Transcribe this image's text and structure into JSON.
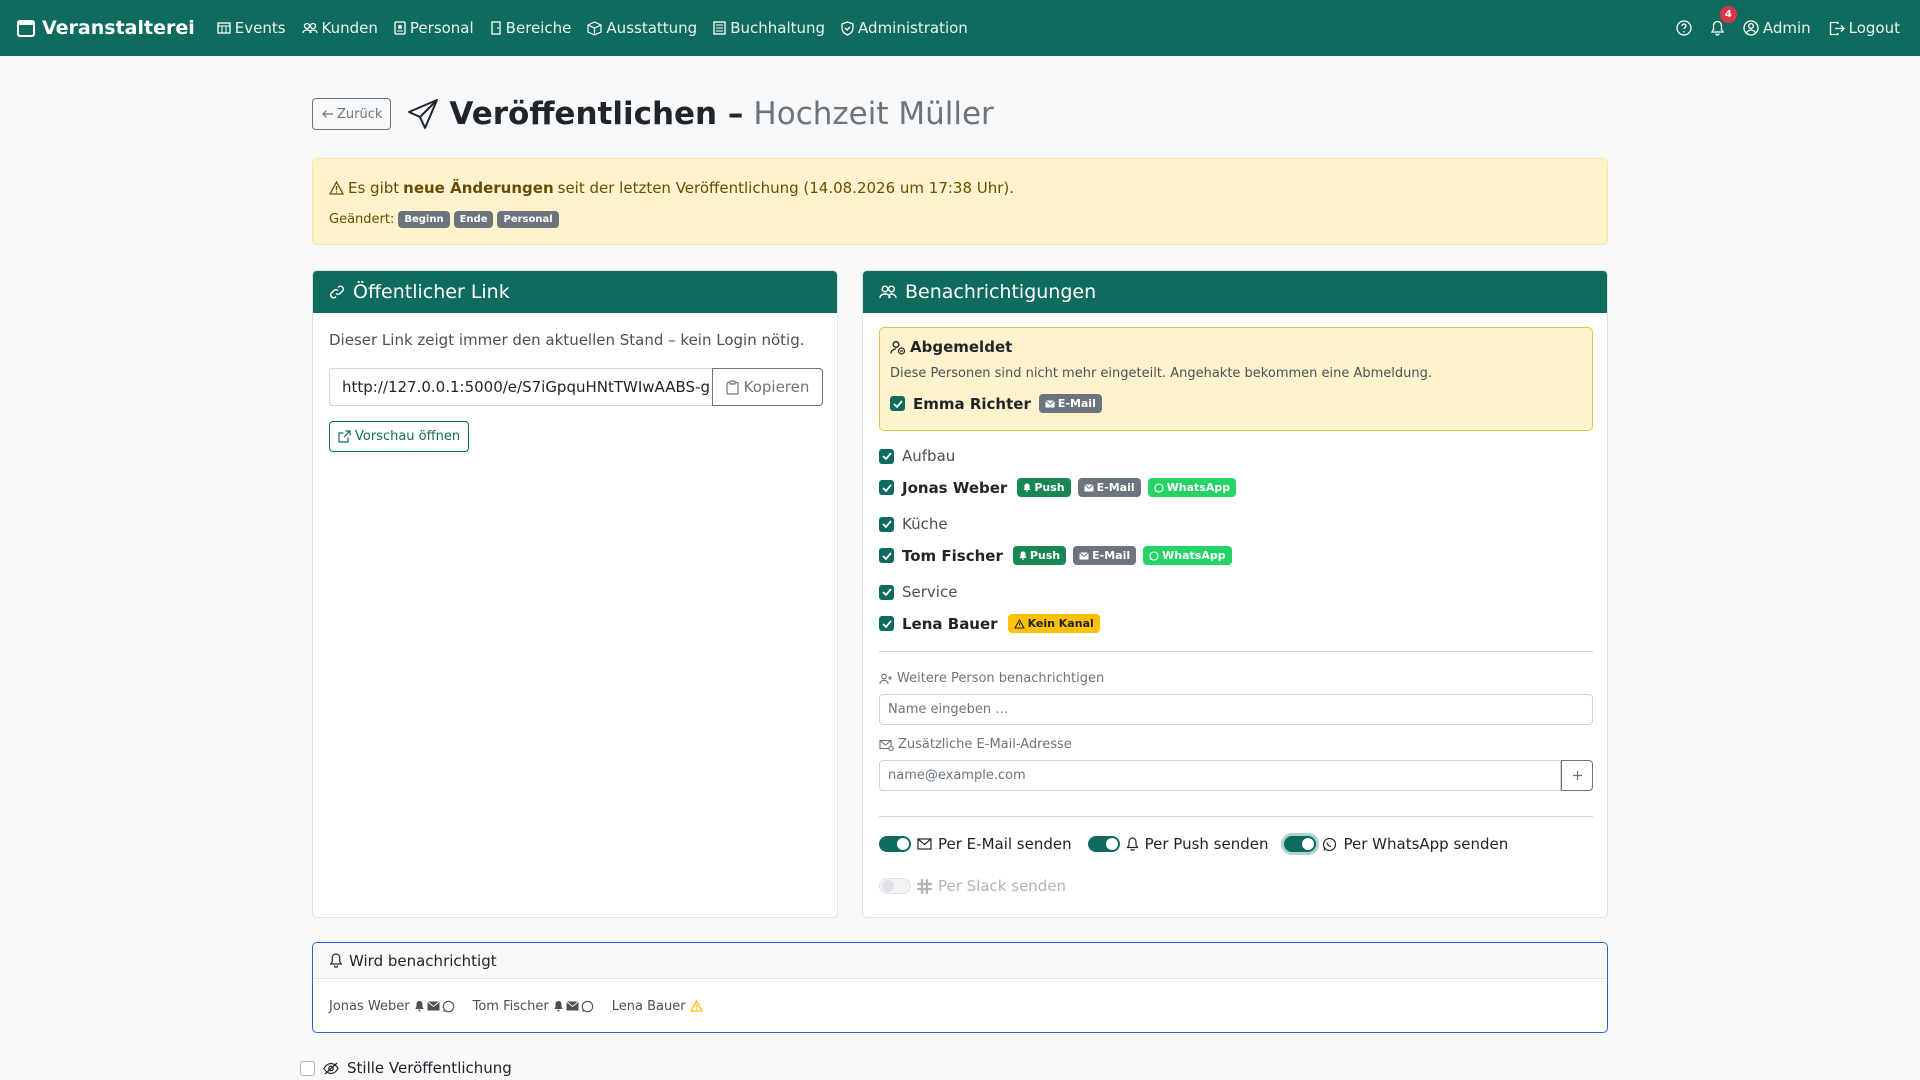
{
  "nav": {
    "brand": "Veranstalterei",
    "links": [
      "Events",
      "Kunden",
      "Personal",
      "Bereiche",
      "Ausstattung",
      "Buchhaltung",
      "Administration"
    ],
    "notification_count": "4",
    "user": "Admin",
    "logout": "Logout"
  },
  "header": {
    "back": "Zurück",
    "title": "Veröffentlichen –",
    "subtitle": "Hochzeit Müller"
  },
  "alert": {
    "pre": "Es gibt",
    "bold": "neue Änderungen",
    "post": "seit der letzten Veröffentlichung (14.08.2026 um 17:38 Uhr).",
    "changed_label": "Geändert:",
    "changes": [
      "Beginn",
      "Ende",
      "Personal"
    ]
  },
  "public_link": {
    "title": "Öffentlicher Link",
    "description": "Dieser Link zeigt immer den aktuellen Stand – kein Login nötig.",
    "url": "http://127.0.0.1:5000/e/S7iGpquHNtTWIwAABS-g",
    "copy": "Kopieren",
    "preview": "Vorschau öffnen"
  },
  "notifications": {
    "title": "Benachrichtigungen",
    "unassigned": {
      "title": "Abgemeldet",
      "description": "Diese Personen sind nicht mehr eingeteilt. Angehakte bekommen eine Abmeldung.",
      "person": "Emma Richter",
      "channel": "E-Mail"
    },
    "groups": [
      {
        "name": "Aufbau",
        "person": "Jonas Weber",
        "channels": [
          "Push",
          "E-Mail",
          "WhatsApp"
        ]
      },
      {
        "name": "Küche",
        "person": "Tom Fischer",
        "channels": [
          "Push",
          "E-Mail",
          "WhatsApp"
        ]
      },
      {
        "name": "Service",
        "person": "Lena Bauer",
        "warning": "Kein Kanal"
      }
    ],
    "extra_person_label": "Weitere Person benachrichtigen",
    "extra_person_placeholder": "Name eingeben …",
    "extra_email_label": "Zusätzliche E-Mail-Adresse",
    "extra_email_placeholder": "name@example.com",
    "toggle_email": "Per E-Mail senden",
    "toggle_push": "Per Push senden",
    "toggle_whatsapp": "Per WhatsApp senden",
    "toggle_slack": "Per Slack senden"
  },
  "will_notify": {
    "title": "Wird benachrichtigt",
    "people": [
      "Jonas Weber",
      "Tom Fischer",
      "Lena Bauer"
    ]
  },
  "silent": "Stille Veröffentlichung",
  "colors": {
    "primary": "#0f6b5d",
    "warning_bg": "#fff3cd",
    "push": "#198754",
    "whatsapp": "#25d366",
    "warn_badge": "#ffc107",
    "danger": "#dc3545"
  }
}
